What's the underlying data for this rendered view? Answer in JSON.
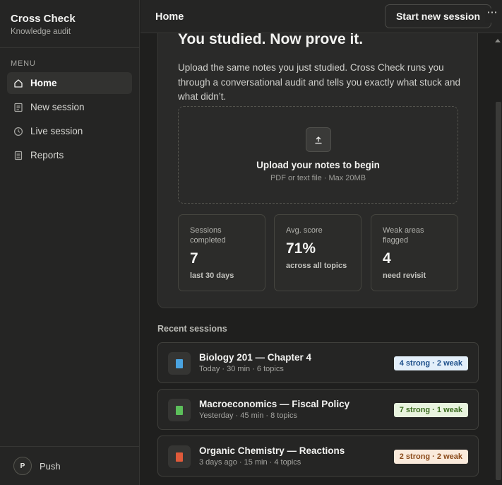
{
  "app": {
    "title": "Cross Check",
    "subtitle": "Knowledge audit"
  },
  "sidebar": {
    "menu_label": "MENU",
    "items": [
      {
        "label": "Home",
        "icon": "home-icon",
        "active": true
      },
      {
        "label": "New session",
        "icon": "document-icon",
        "active": false
      },
      {
        "label": "Live session",
        "icon": "clock-icon",
        "active": false
      },
      {
        "label": "Reports",
        "icon": "report-icon",
        "active": false
      }
    ],
    "user": {
      "initial": "P",
      "name": "Push"
    }
  },
  "topbar": {
    "title": "Home",
    "start_label": "Start new session",
    "more_label": "⋯"
  },
  "hero": {
    "title": "You studied. Now prove it.",
    "description": "Upload the same notes you just studied. Cross Check runs you through a conversational audit and tells you exactly what stuck and what didn’t.",
    "upload_title": "Upload your notes to begin",
    "upload_sub": "PDF or text file · Max 20MB"
  },
  "stats": [
    {
      "label": "Sessions completed",
      "value": "7",
      "sub": "last 30 days"
    },
    {
      "label": "Avg. score",
      "value": "71%",
      "sub": "across all topics"
    },
    {
      "label": "Weak areas flagged",
      "value": "4",
      "sub": "need revisit"
    }
  ],
  "recent": {
    "heading": "Recent sessions",
    "sessions": [
      {
        "title": "Biology 201 — Chapter 4",
        "meta": "Today · 30 min · 6 topics",
        "badge": "4 strong · 2 weak",
        "book_color": "#4aa3e0",
        "badge_bg": "#e3effa",
        "badge_fg": "#1d4f8a"
      },
      {
        "title": "Macroeconomics — Fiscal Policy",
        "meta": "Yesterday · 45 min · 8 topics",
        "badge": "7 strong · 1 weak",
        "book_color": "#5cbf5a",
        "badge_bg": "#e8f3de",
        "badge_fg": "#3a6b1e"
      },
      {
        "title": "Organic Chemistry — Reactions",
        "meta": "3 days ago · 15 min · 4 topics",
        "badge": "2 strong · 2 weak",
        "book_color": "#e05a3a",
        "badge_bg": "#faeadb",
        "badge_fg": "#8a4a1a"
      }
    ]
  }
}
